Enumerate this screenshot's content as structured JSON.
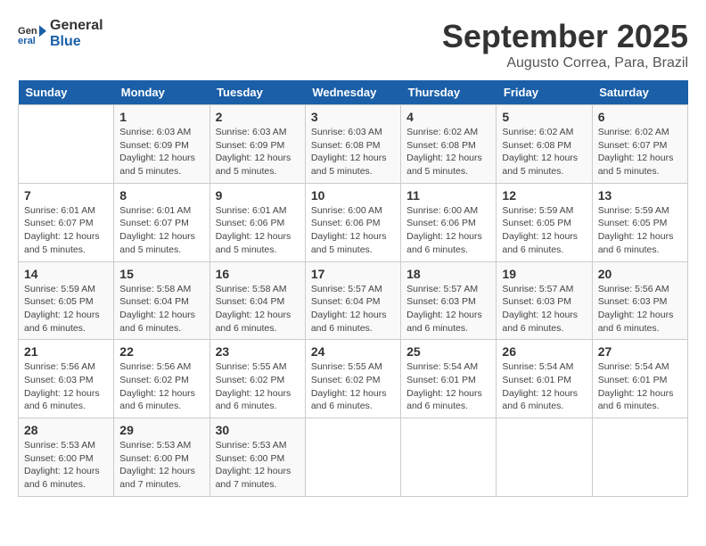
{
  "header": {
    "logo_line1": "General",
    "logo_line2": "Blue",
    "month_title": "September 2025",
    "subtitle": "Augusto Correa, Para, Brazil"
  },
  "days_of_week": [
    "Sunday",
    "Monday",
    "Tuesday",
    "Wednesday",
    "Thursday",
    "Friday",
    "Saturday"
  ],
  "weeks": [
    [
      {
        "num": "",
        "info": ""
      },
      {
        "num": "1",
        "info": "Sunrise: 6:03 AM\nSunset: 6:09 PM\nDaylight: 12 hours\nand 5 minutes."
      },
      {
        "num": "2",
        "info": "Sunrise: 6:03 AM\nSunset: 6:09 PM\nDaylight: 12 hours\nand 5 minutes."
      },
      {
        "num": "3",
        "info": "Sunrise: 6:03 AM\nSunset: 6:08 PM\nDaylight: 12 hours\nand 5 minutes."
      },
      {
        "num": "4",
        "info": "Sunrise: 6:02 AM\nSunset: 6:08 PM\nDaylight: 12 hours\nand 5 minutes."
      },
      {
        "num": "5",
        "info": "Sunrise: 6:02 AM\nSunset: 6:08 PM\nDaylight: 12 hours\nand 5 minutes."
      },
      {
        "num": "6",
        "info": "Sunrise: 6:02 AM\nSunset: 6:07 PM\nDaylight: 12 hours\nand 5 minutes."
      }
    ],
    [
      {
        "num": "7",
        "info": "Sunrise: 6:01 AM\nSunset: 6:07 PM\nDaylight: 12 hours\nand 5 minutes."
      },
      {
        "num": "8",
        "info": "Sunrise: 6:01 AM\nSunset: 6:07 PM\nDaylight: 12 hours\nand 5 minutes."
      },
      {
        "num": "9",
        "info": "Sunrise: 6:01 AM\nSunset: 6:06 PM\nDaylight: 12 hours\nand 5 minutes."
      },
      {
        "num": "10",
        "info": "Sunrise: 6:00 AM\nSunset: 6:06 PM\nDaylight: 12 hours\nand 5 minutes."
      },
      {
        "num": "11",
        "info": "Sunrise: 6:00 AM\nSunset: 6:06 PM\nDaylight: 12 hours\nand 6 minutes."
      },
      {
        "num": "12",
        "info": "Sunrise: 5:59 AM\nSunset: 6:05 PM\nDaylight: 12 hours\nand 6 minutes."
      },
      {
        "num": "13",
        "info": "Sunrise: 5:59 AM\nSunset: 6:05 PM\nDaylight: 12 hours\nand 6 minutes."
      }
    ],
    [
      {
        "num": "14",
        "info": "Sunrise: 5:59 AM\nSunset: 6:05 PM\nDaylight: 12 hours\nand 6 minutes."
      },
      {
        "num": "15",
        "info": "Sunrise: 5:58 AM\nSunset: 6:04 PM\nDaylight: 12 hours\nand 6 minutes."
      },
      {
        "num": "16",
        "info": "Sunrise: 5:58 AM\nSunset: 6:04 PM\nDaylight: 12 hours\nand 6 minutes."
      },
      {
        "num": "17",
        "info": "Sunrise: 5:57 AM\nSunset: 6:04 PM\nDaylight: 12 hours\nand 6 minutes."
      },
      {
        "num": "18",
        "info": "Sunrise: 5:57 AM\nSunset: 6:03 PM\nDaylight: 12 hours\nand 6 minutes."
      },
      {
        "num": "19",
        "info": "Sunrise: 5:57 AM\nSunset: 6:03 PM\nDaylight: 12 hours\nand 6 minutes."
      },
      {
        "num": "20",
        "info": "Sunrise: 5:56 AM\nSunset: 6:03 PM\nDaylight: 12 hours\nand 6 minutes."
      }
    ],
    [
      {
        "num": "21",
        "info": "Sunrise: 5:56 AM\nSunset: 6:03 PM\nDaylight: 12 hours\nand 6 minutes."
      },
      {
        "num": "22",
        "info": "Sunrise: 5:56 AM\nSunset: 6:02 PM\nDaylight: 12 hours\nand 6 minutes."
      },
      {
        "num": "23",
        "info": "Sunrise: 5:55 AM\nSunset: 6:02 PM\nDaylight: 12 hours\nand 6 minutes."
      },
      {
        "num": "24",
        "info": "Sunrise: 5:55 AM\nSunset: 6:02 PM\nDaylight: 12 hours\nand 6 minutes."
      },
      {
        "num": "25",
        "info": "Sunrise: 5:54 AM\nSunset: 6:01 PM\nDaylight: 12 hours\nand 6 minutes."
      },
      {
        "num": "26",
        "info": "Sunrise: 5:54 AM\nSunset: 6:01 PM\nDaylight: 12 hours\nand 6 minutes."
      },
      {
        "num": "27",
        "info": "Sunrise: 5:54 AM\nSunset: 6:01 PM\nDaylight: 12 hours\nand 6 minutes."
      }
    ],
    [
      {
        "num": "28",
        "info": "Sunrise: 5:53 AM\nSunset: 6:00 PM\nDaylight: 12 hours\nand 6 minutes."
      },
      {
        "num": "29",
        "info": "Sunrise: 5:53 AM\nSunset: 6:00 PM\nDaylight: 12 hours\nand 7 minutes."
      },
      {
        "num": "30",
        "info": "Sunrise: 5:53 AM\nSunset: 6:00 PM\nDaylight: 12 hours\nand 7 minutes."
      },
      {
        "num": "",
        "info": ""
      },
      {
        "num": "",
        "info": ""
      },
      {
        "num": "",
        "info": ""
      },
      {
        "num": "",
        "info": ""
      }
    ]
  ]
}
